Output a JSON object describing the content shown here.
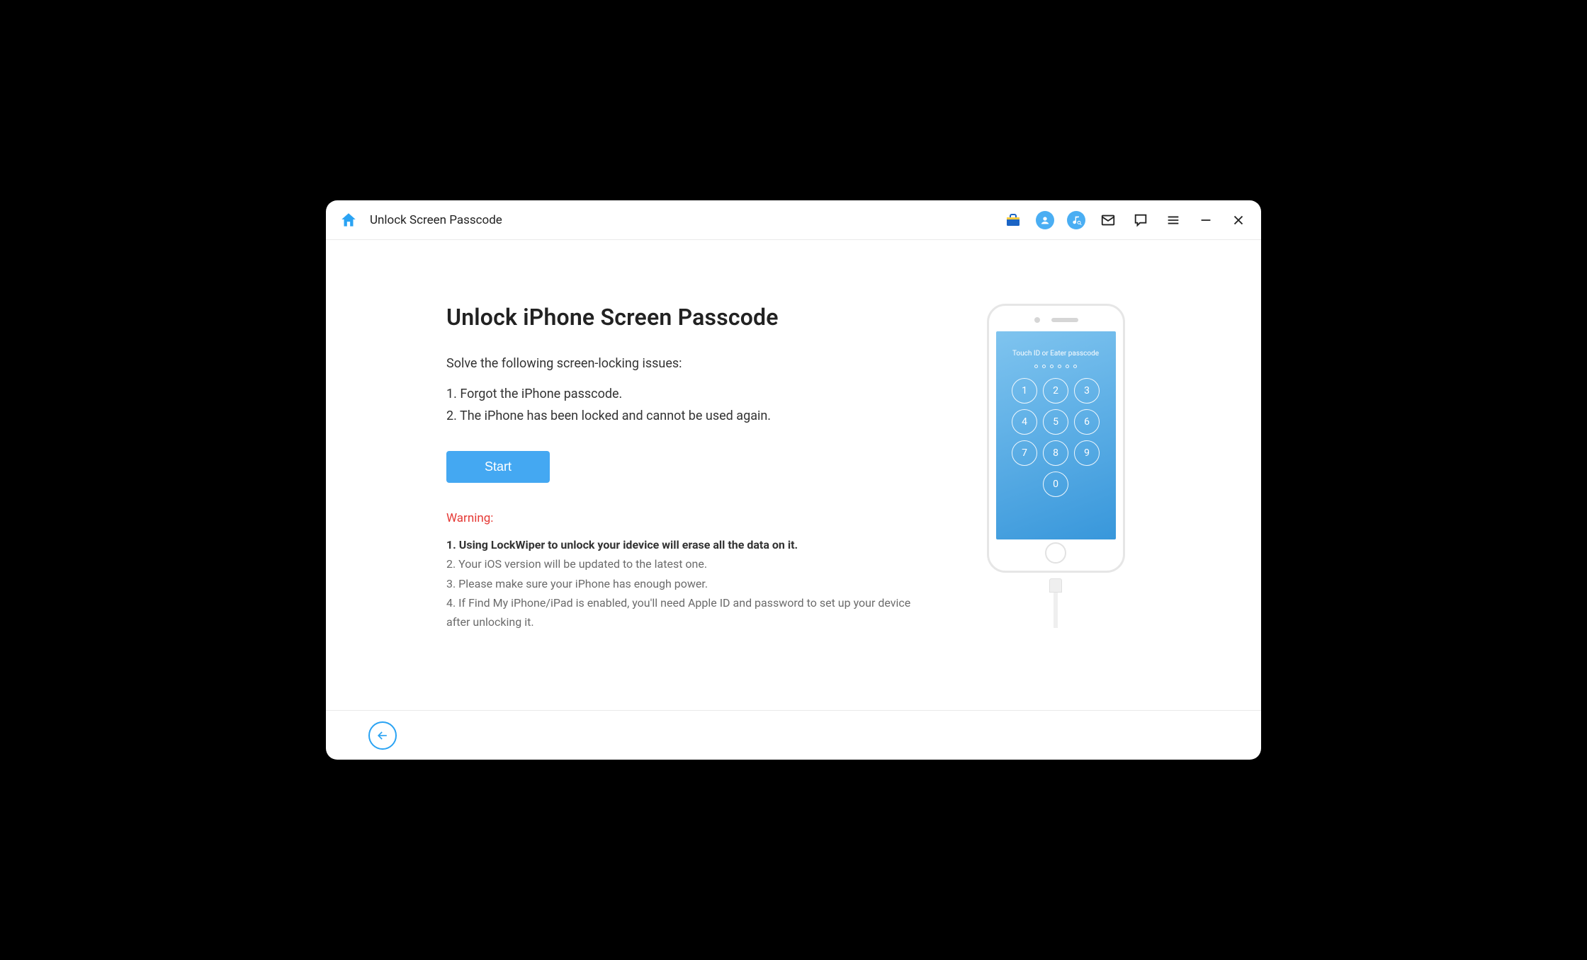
{
  "titlebar": {
    "title": "Unlock Screen Passcode"
  },
  "main": {
    "heading": "Unlock iPhone Screen Passcode",
    "subhead": "Solve the following screen-locking issues:",
    "issues": [
      "1. Forgot the iPhone passcode.",
      "2. The iPhone has been locked and cannot be used again."
    ],
    "start_label": "Start",
    "warning_label": "Warning:",
    "warnings": [
      "1. Using LockWiper to unlock your idevice will erase all the data on it.",
      "2. Your iOS version will be updated to the latest one.",
      "3. Please make sure your iPhone has enough power.",
      "4. If Find My iPhone/iPad is enabled, you'll need Apple ID and password to set up your device after unlocking it."
    ]
  },
  "phone": {
    "lock_label": "Touch ID or Eater passcode",
    "keys": [
      "1",
      "2",
      "3",
      "4",
      "5",
      "6",
      "7",
      "8",
      "9",
      "0"
    ]
  },
  "colors": {
    "accent": "#44a8f2",
    "warning": "#e53935"
  }
}
